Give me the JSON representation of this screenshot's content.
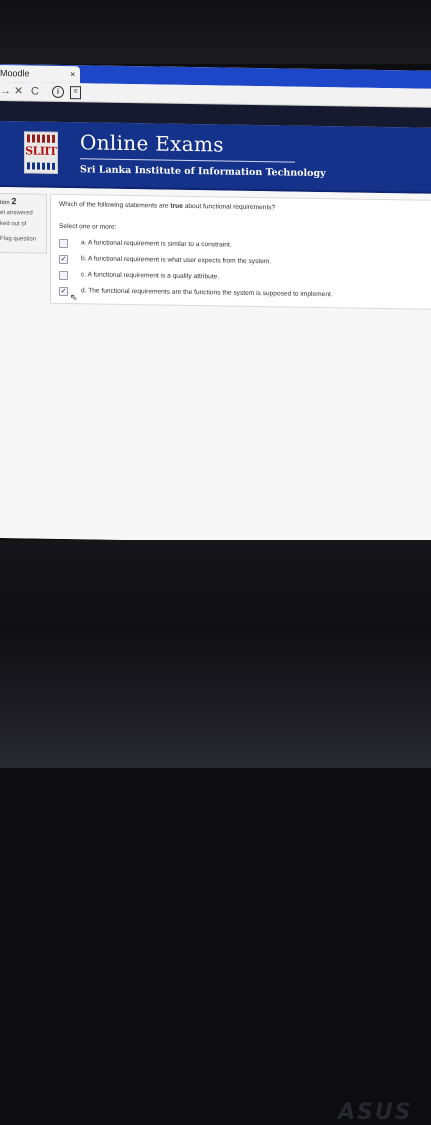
{
  "browser": {
    "tab_title": "Moodle",
    "tab_close": "×",
    "back_arrow": "→",
    "stop": "✕",
    "reload": "C",
    "info_icon": "i",
    "doc_icon": "≡"
  },
  "header": {
    "logo_text": "SLIIT",
    "title": "Online Exams",
    "subtitle": "Sri Lanka Institute of Information Technology"
  },
  "question_info": {
    "number_label": "tion",
    "number": "2",
    "state": "et answered",
    "mark": "ked out of",
    "flag": "Flag question"
  },
  "question": {
    "text_before": "Which of the following statements are ",
    "text_bold": "true",
    "text_after": " about functional requirements?",
    "prompt": "Select one or more:",
    "options": [
      {
        "label": "a. A functional requirement is similar to a constraint.",
        "checked": false
      },
      {
        "label": "b. A functional requirement is what user expects from the system.",
        "checked": true
      },
      {
        "label": "c. A functional requirement is a quality attribute.",
        "checked": false
      },
      {
        "label": "d. The functional requirements are the functions the system is supposed to implement.",
        "checked": true
      }
    ]
  },
  "device": {
    "brand": "ASUS"
  },
  "colors": {
    "tab_bar": "#1e47c8",
    "header_bg": "#15328a",
    "logo_red": "#b51414"
  }
}
